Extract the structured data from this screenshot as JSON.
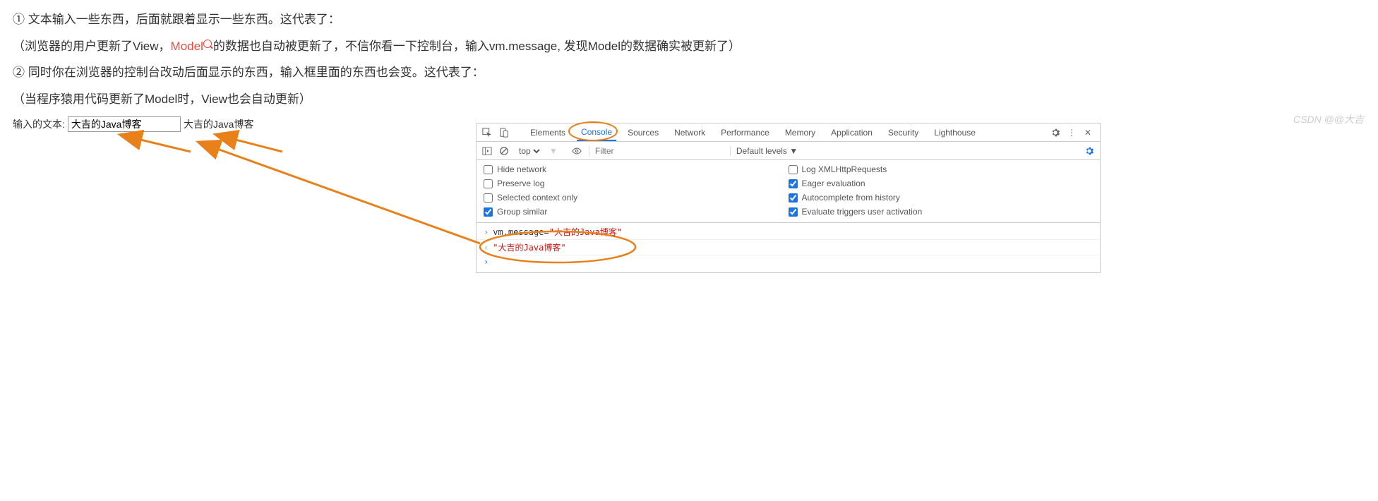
{
  "article": {
    "p1": "① 文本输入一些东西，后面就跟着显示一些东西。这代表了：",
    "p2_before": "（浏览器的用户更新了View，",
    "p2_red": "Model",
    "p2_after": "的数据也自动被更新了，不信你看一下控制台，输入vm.message, 发现Model的数据确实被更新了）",
    "p3": "② 同时你在浏览器的控制台改动后面显示的东西，输入框里面的东西也会变。这代表了：",
    "p4": "（当程序猿用代码更新了Model时，View也会自动更新）"
  },
  "demo": {
    "label": "输入的文本:",
    "input_value": "大吉的Java博客",
    "output": "大吉的Java博客"
  },
  "devtools": {
    "tabs": [
      "Elements",
      "Console",
      "Sources",
      "Network",
      "Performance",
      "Memory",
      "Application",
      "Security",
      "Lighthouse"
    ],
    "active_tab": "Console",
    "context": "top",
    "filter_placeholder": "Filter",
    "levels": "Default levels ▼",
    "settings_left": [
      {
        "label": "Hide network",
        "checked": false
      },
      {
        "label": "Preserve log",
        "checked": false
      },
      {
        "label": "Selected context only",
        "checked": false
      },
      {
        "label": "Group similar",
        "checked": true
      }
    ],
    "settings_right": [
      {
        "label": "Log XMLHttpRequests",
        "checked": false
      },
      {
        "label": "Eager evaluation",
        "checked": true
      },
      {
        "label": "Autocomplete from history",
        "checked": true
      },
      {
        "label": "Evaluate triggers user activation",
        "checked": true
      }
    ],
    "console": {
      "input_var": "vm.message",
      "input_op": "=",
      "input_str": "\"大吉的Java博客\"",
      "output_str": "\"大吉的Java博客\""
    }
  },
  "watermark": "CSDN @@大吉"
}
